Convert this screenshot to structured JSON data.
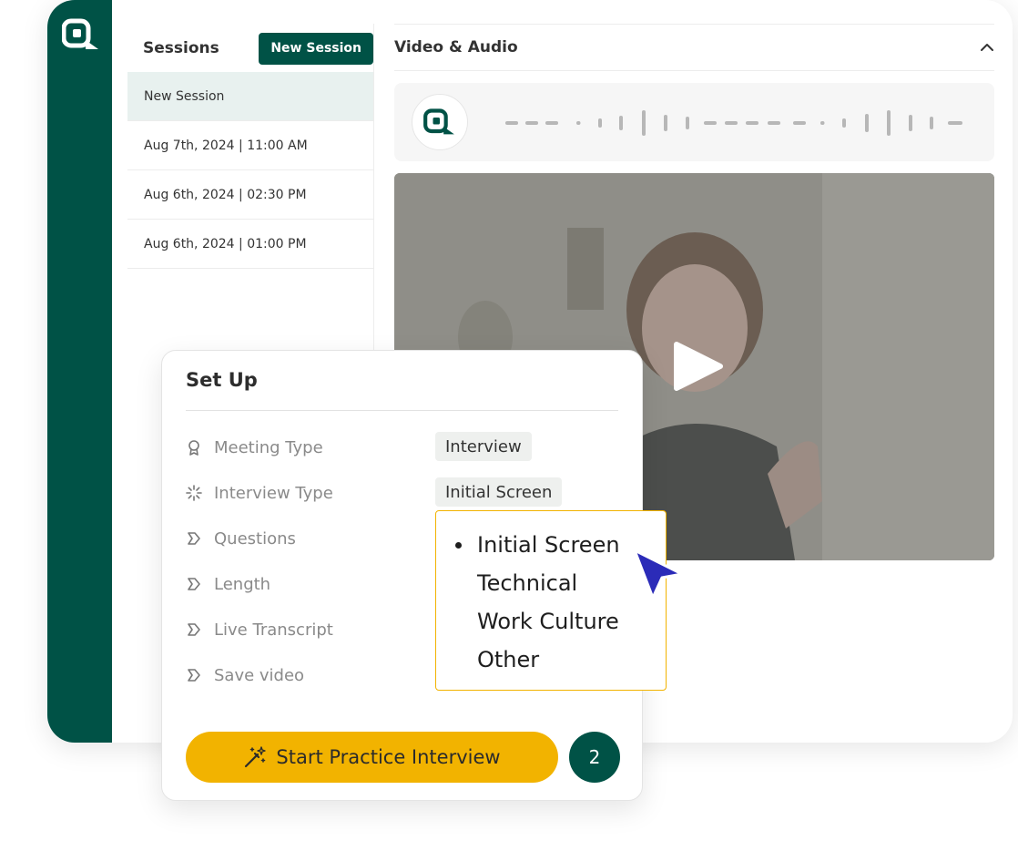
{
  "sessions": {
    "title": "Sessions",
    "new_button": "New Session",
    "items": [
      {
        "label": "New Session"
      },
      {
        "label": "Aug 7th, 2024 | 11:00 AM"
      },
      {
        "label": "Aug 6th, 2024 | 02:30 PM"
      },
      {
        "label": "Aug 6th, 2024 | 01:00 PM"
      }
    ]
  },
  "media": {
    "title": "Video & Audio"
  },
  "setup": {
    "title": "Set Up",
    "rows": [
      {
        "label": "Meeting Type",
        "value": "Interview",
        "icon": "award-icon"
      },
      {
        "label": "Interview Type",
        "value": "Initial Screen",
        "icon": "loader-icon"
      },
      {
        "label": "Questions",
        "icon": "chevron-step-icon"
      },
      {
        "label": "Length",
        "icon": "chevron-step-icon"
      },
      {
        "label": "Live Transcript",
        "icon": "chevron-step-icon"
      },
      {
        "label": "Save video",
        "icon": "chevron-step-icon"
      }
    ],
    "start_button": "Start Practice Interview",
    "step_badge": "2"
  },
  "dropdown": {
    "options": [
      "Initial Screen",
      "Technical",
      "Work Culture",
      "Other"
    ],
    "selected": "Initial Screen"
  },
  "colors": {
    "brand": "#005246",
    "accent": "#f2b300",
    "cursor": "#2b2bb8"
  }
}
